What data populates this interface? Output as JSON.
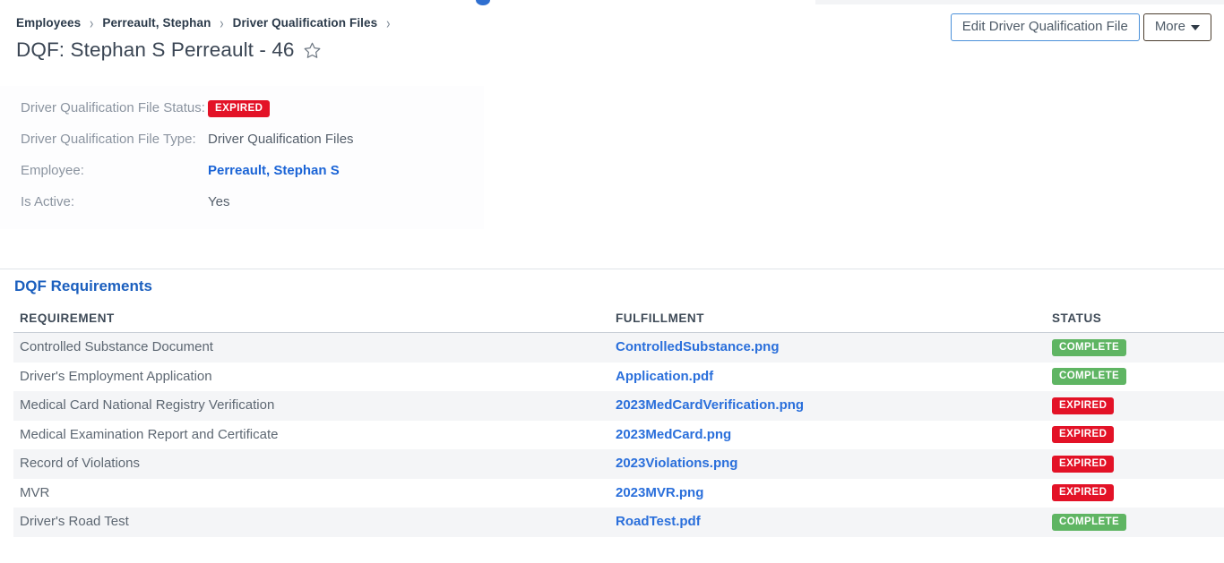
{
  "breadcrumb": {
    "items": [
      {
        "label": "Employees"
      },
      {
        "label": "Perreault, Stephan"
      },
      {
        "label": "Driver Qualification Files"
      }
    ],
    "separator": "›"
  },
  "header": {
    "title": "DQF: Stephan S Perreault - 46",
    "star_icon": "star-outline-icon"
  },
  "actions": {
    "edit_label": "Edit Driver Qualification File",
    "more_label": "More",
    "caret_icon": "caret-down-icon"
  },
  "details": [
    {
      "label": "Driver Qualification File Status:",
      "type": "badge",
      "value": "EXPIRED",
      "badge_style": "expired"
    },
    {
      "label": "Driver Qualification File Type:",
      "type": "text",
      "value": "Driver Qualification Files"
    },
    {
      "label": "Employee:",
      "type": "link",
      "value": "Perreault, Stephan S"
    },
    {
      "label": "Is Active:",
      "type": "text",
      "value": "Yes"
    }
  ],
  "requirements_section": {
    "title": "DQF Requirements",
    "columns": {
      "requirement": "REQUIREMENT",
      "fulfillment": "FULFILLMENT",
      "status": "STATUS"
    },
    "rows": [
      {
        "requirement": "Controlled Substance Document",
        "fulfillment": "ControlledSubstance.png",
        "status": "COMPLETE",
        "status_style": "complete"
      },
      {
        "requirement": "Driver's Employment Application",
        "fulfillment": "Application.pdf",
        "status": "COMPLETE",
        "status_style": "complete"
      },
      {
        "requirement": "Medical Card National Registry Verification",
        "fulfillment": "2023MedCardVerification.png",
        "status": "EXPIRED",
        "status_style": "expired"
      },
      {
        "requirement": "Medical Examination Report and Certificate",
        "fulfillment": "2023MedCard.png",
        "status": "EXPIRED",
        "status_style": "expired"
      },
      {
        "requirement": "Record of Violations",
        "fulfillment": "2023Violations.png",
        "status": "EXPIRED",
        "status_style": "expired"
      },
      {
        "requirement": "MVR",
        "fulfillment": "2023MVR.png",
        "status": "EXPIRED",
        "status_style": "expired"
      },
      {
        "requirement": "Driver's Road Test",
        "fulfillment": "RoadTest.pdf",
        "status": "COMPLETE",
        "status_style": "complete"
      }
    ]
  },
  "colors": {
    "link": "#2a6fdb",
    "section_title": "#1b5fbe",
    "badge_expired": "#e31227",
    "badge_complete": "#5fb563",
    "row_stripe": "#f4f5f7",
    "edit_button_border": "#4a90d9",
    "more_button_border": "#4b3d2e"
  }
}
